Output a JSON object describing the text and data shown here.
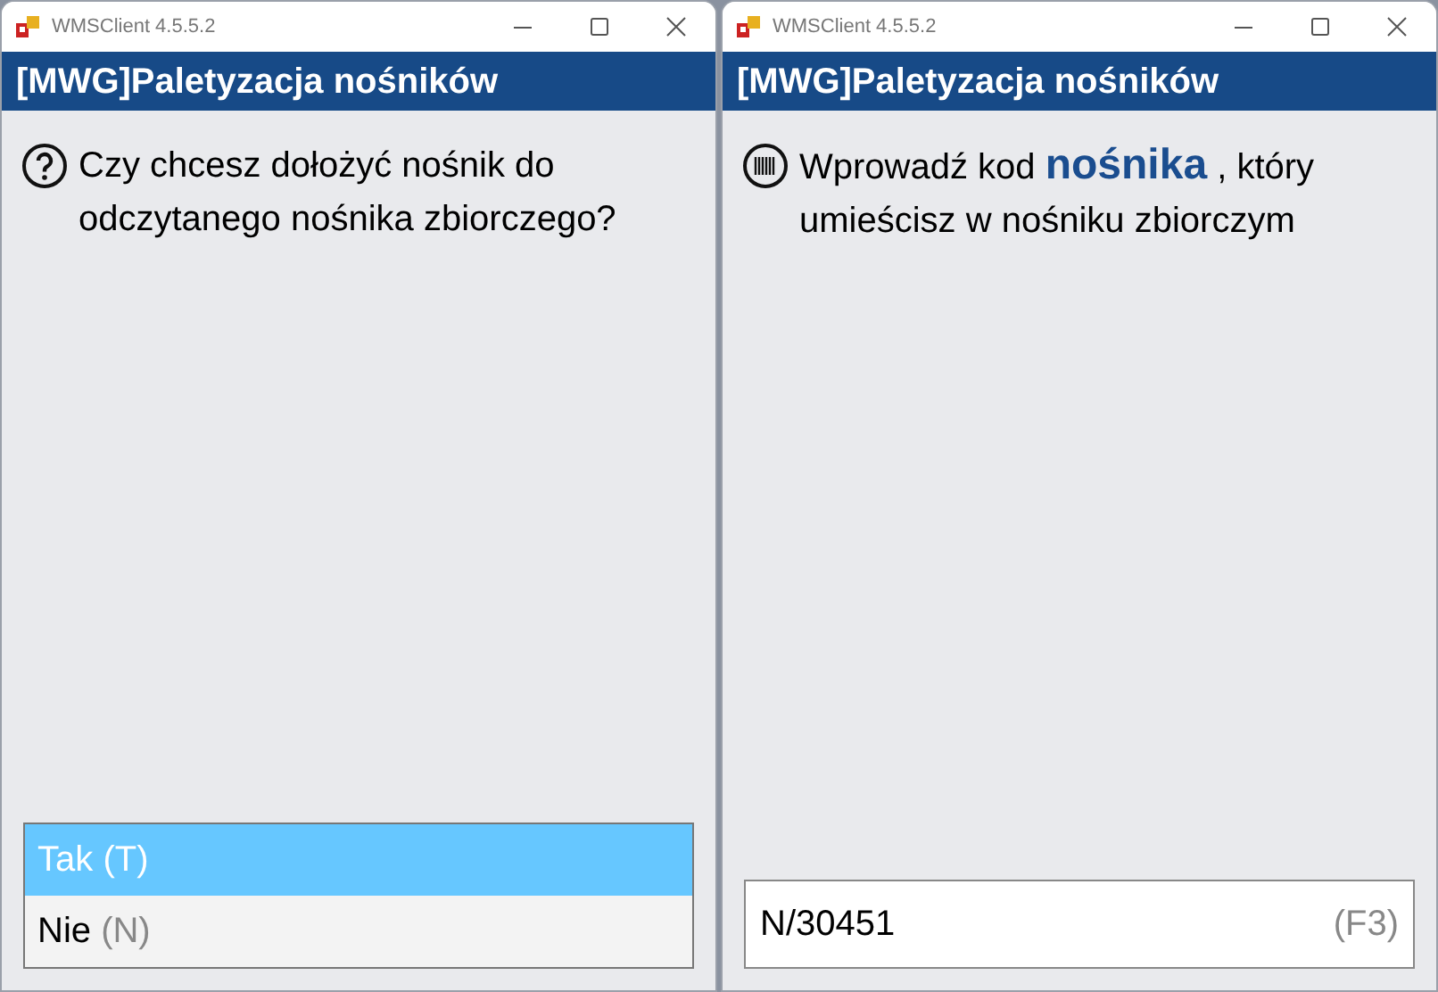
{
  "windows": [
    {
      "title": "WMSClient 4.5.5.2",
      "header": "[MWG]Paletyzacja nośników",
      "prompt": {
        "kind": "question",
        "text": "Czy chcesz dołożyć nośnik do odczytanego nośnika zbiorczego?"
      },
      "kind": "options",
      "options": [
        {
          "label": "Tak",
          "shortcut": "(T)",
          "selected": true
        },
        {
          "label": "Nie",
          "shortcut": "(N)",
          "selected": false
        }
      ]
    },
    {
      "title": "WMSClient 4.5.5.2",
      "header": "[MWG]Paletyzacja nośników",
      "prompt": {
        "kind": "barcode",
        "text": "Wprowadź kod **nośnika** , który umieścisz w nośniku zbiorczym"
      },
      "kind": "input",
      "input": {
        "value": "N/30451",
        "shortcut": "(F3)"
      }
    }
  ]
}
